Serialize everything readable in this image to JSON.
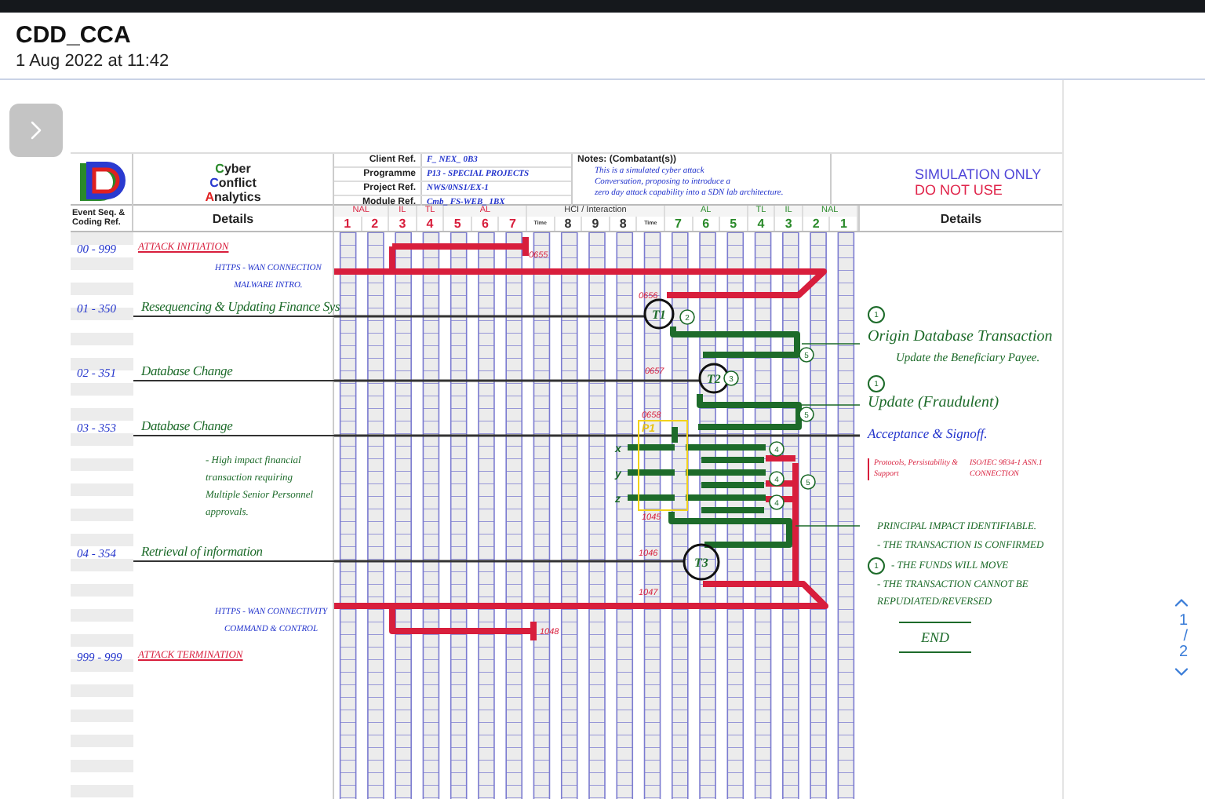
{
  "app": {
    "title": "CDD_CCA",
    "date": "1 Aug 2022 at 11:42"
  },
  "document": {
    "brand": [
      {
        "word": "Cyber",
        "color": "#2a8a2a"
      },
      {
        "word": "Conflict",
        "color": "#2a3ad0"
      },
      {
        "word": "Analytics",
        "color": "#e02020"
      }
    ],
    "refs": [
      {
        "label": "Client Ref.",
        "value": "F_ NEX_ 0B3"
      },
      {
        "label": "Programme",
        "value": "P13 - SPECIAL PROJECTS"
      },
      {
        "label": "Project Ref.",
        "value": "NWS/0NS1/EX-1"
      },
      {
        "label": "Module Ref.",
        "value": "Cmb_ FS-WEB_ 1BX"
      }
    ],
    "notes": {
      "label": "Notes: (Combatant(s))",
      "lines": [
        "This is a simulated cyber attack",
        "Conversation, proposing to introduce a",
        "zero day attack capability into a SDN lab architecture."
      ]
    },
    "warning": [
      {
        "text": "SIMULATION ONLY",
        "kind": "info"
      },
      {
        "text": "DO NOT USE",
        "kind": "alert"
      }
    ],
    "event_header": "Event Seq. & Coding Ref.",
    "details_left": "Details",
    "details_right": "Details",
    "column_groups": [
      {
        "label": "NAL",
        "kind": "left"
      },
      {
        "label": "IL",
        "kind": "left"
      },
      {
        "label": "TL",
        "kind": "left"
      },
      {
        "label": "AL",
        "kind": "left"
      },
      {
        "label": "HCI / Interaction",
        "kind": "mid"
      },
      {
        "label": "AL",
        "kind": "right"
      },
      {
        "label": "TL",
        "kind": "right"
      },
      {
        "label": "IL",
        "kind": "right"
      },
      {
        "label": "NAL",
        "kind": "right"
      }
    ],
    "columns": [
      {
        "label": "1",
        "kind": "left"
      },
      {
        "label": "2",
        "kind": "left"
      },
      {
        "label": "3",
        "kind": "left"
      },
      {
        "label": "4",
        "kind": "left"
      },
      {
        "label": "5",
        "kind": "left"
      },
      {
        "label": "6",
        "kind": "left"
      },
      {
        "label": "7",
        "kind": "left"
      },
      {
        "label": "Time",
        "kind": "time"
      },
      {
        "label": "8",
        "kind": "mid"
      },
      {
        "label": "9",
        "kind": "mid"
      },
      {
        "label": "8",
        "kind": "mid"
      },
      {
        "label": "Time",
        "kind": "time"
      },
      {
        "label": "7",
        "kind": "right"
      },
      {
        "label": "6",
        "kind": "right"
      },
      {
        "label": "5",
        "kind": "right"
      },
      {
        "label": "4",
        "kind": "right"
      },
      {
        "label": "3",
        "kind": "right"
      },
      {
        "label": "2",
        "kind": "right"
      },
      {
        "label": "1",
        "kind": "right"
      }
    ],
    "entries": [
      {
        "kind": "terminal",
        "code": "00 - 999",
        "title": "ATTACK INITIATION"
      },
      {
        "kind": "note",
        "color": "#2233cc",
        "lines": [
          "HTTPS - WAN CONNECTION",
          "MALWARE INTRO."
        ]
      },
      {
        "kind": "step",
        "code": "01 - 350",
        "title": "Resequencing & Updating Finance Sys"
      },
      {
        "kind": "step",
        "code": "02 - 351",
        "title": "Database Change"
      },
      {
        "kind": "step",
        "code": "03 - 353",
        "title": "Database Change"
      },
      {
        "kind": "note",
        "color": "#1d6b2a",
        "lines": [
          "- High impact financial",
          "transaction requiring",
          "Multiple Senior Personnel",
          "approvals."
        ]
      },
      {
        "kind": "step",
        "code": "04 - 354",
        "title": "Retrieval of information"
      },
      {
        "kind": "note",
        "color": "#2233cc",
        "lines": [
          "HTTPS - WAN CONNECTIVITY",
          "COMMAND & CONTROL"
        ]
      },
      {
        "kind": "terminal",
        "code": "999 - 999",
        "title": "ATTACK TERMINATION"
      }
    ],
    "timeline": {
      "times": [
        "0655",
        "0656",
        "0657",
        "0658",
        "1045",
        "1046",
        "1047",
        "1048"
      ],
      "nodes": [
        "T1",
        "T2",
        "T3"
      ],
      "markers": [
        "2",
        "3",
        "5",
        "5",
        "4",
        "4",
        "4",
        "5"
      ],
      "branches": [
        "x",
        "y",
        "z"
      ],
      "process": "P1"
    },
    "outcomes": [
      {
        "kind": "marker",
        "text": "1"
      },
      {
        "kind": "step",
        "text": "Origin Database Transaction"
      },
      {
        "kind": "sub",
        "text": "Update the Beneficiary Payee."
      },
      {
        "kind": "marker",
        "text": "1"
      },
      {
        "kind": "step",
        "text": "Update (Fraudulent)"
      },
      {
        "kind": "signoff",
        "text": "Acceptance & Signoff."
      },
      {
        "kind": "protocol",
        "texts": [
          "Protocols, Persistability & Support",
          "ISO/IEC 9834-1 ASN.1 CONNECTION"
        ]
      },
      {
        "kind": "caps",
        "text": "PRINCIPAL IMPACT IDENTIFIABLE."
      },
      {
        "kind": "caps",
        "text": "- THE TRANSACTION IS CONFIRMED"
      },
      {
        "kind": "caps",
        "marker": "1",
        "text": "- THE FUNDS WILL MOVE"
      },
      {
        "kind": "caps",
        "text": "- THE TRANSACTION CANNOT BE REPUDIATED/REVERSED"
      },
      {
        "kind": "end",
        "text": "END"
      }
    ]
  },
  "pager": {
    "page": "1",
    "separator": "/",
    "total": "2"
  }
}
